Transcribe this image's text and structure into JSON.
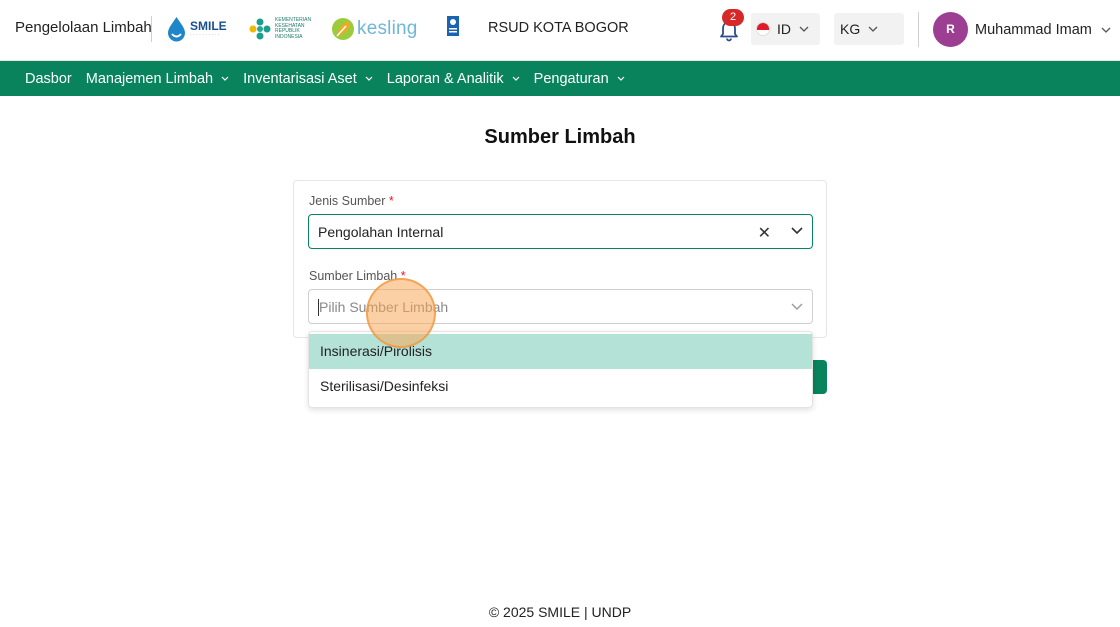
{
  "header": {
    "app_title": "Pengelolaan Limbah",
    "logos": {
      "smile": "SMILE",
      "kemenkes": "KEMENTERIAN KESEHATAN REPUBLIK INDONESIA",
      "kesling": "kesling"
    },
    "hospital": "RSUD KOTA BOGOR",
    "notification_count": "2",
    "language": "ID",
    "unit": "KG",
    "user": {
      "initial": "R",
      "name": "Muhammad Imam"
    }
  },
  "nav": {
    "items": [
      {
        "label": "Dasbor"
      },
      {
        "label": "Manajemen Limbah"
      },
      {
        "label": "Inventarisasi Aset"
      },
      {
        "label": "Laporan & Analitik"
      },
      {
        "label": "Pengaturan"
      }
    ]
  },
  "main": {
    "title": "Sumber Limbah",
    "jenis_sumber": {
      "label": "Jenis Sumber",
      "required": "*",
      "value": "Pengolahan Internal"
    },
    "sumber_limbah": {
      "label": "Sumber Limbah",
      "required": "*",
      "placeholder": "Pilih Sumber Limbah",
      "options": [
        "Insinerasi/Pirolisis",
        "Sterilisasi/Desinfeksi"
      ]
    }
  },
  "footer": {
    "text": "© 2025 SMILE | UNDP"
  },
  "colors": {
    "brand_green": "#08835b",
    "option_highlight": "#b5e2d6",
    "badge_red": "#d62828",
    "avatar_purple": "#9c3e92"
  }
}
